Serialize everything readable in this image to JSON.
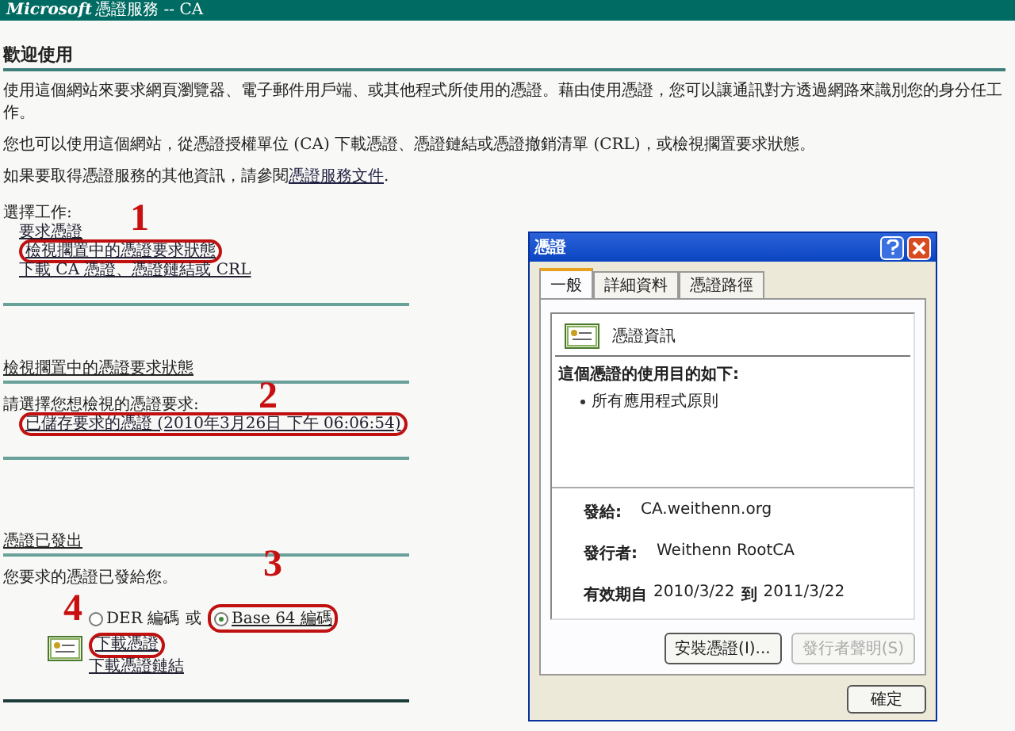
{
  "header": {
    "brand": "Microsoft",
    "title": "憑證服務 --  CA"
  },
  "welcome": {
    "heading": "歡迎使用",
    "paragraphs": [
      "使用這個網站來要求網頁瀏覽器、電子郵件用戶端、或其他程式所使用的憑證。藉由使用憑證，您可以讓通訊對方透過網路來識別您的身分任工作。",
      "您也可以使用這個網站，從憑證授權單位 (CA) 下載憑證、憑證鏈結或憑證撤銷清單 (CRL)，或檢視擱置要求狀態。"
    ],
    "more_info": {
      "text": "如果要取得憑證服務的其他資訊，請參閱",
      "link": "憑證服務文件",
      "end": "."
    }
  },
  "tasks": {
    "label": "選擇工作:",
    "links": [
      {
        "text": "要求憑證",
        "circled": false
      },
      {
        "text": "檢視擱置中的憑證要求狀態",
        "circled": true
      },
      {
        "text": "下載 CA 憑證、憑證鏈結或 CRL",
        "circled": false
      }
    ]
  },
  "pending": {
    "heading": "檢視擱置中的憑證要求狀態",
    "prompt": "請選擇您想檢視的憑證要求:",
    "links": [
      {
        "text": "已儲存要求的憑證 (2010年3月26日 下午 06:06:54)",
        "circled": true
      }
    ]
  },
  "issued": {
    "heading": "憑證已發出",
    "message": "您要求的憑證已發給您。",
    "separator": "或",
    "encodings": [
      {
        "label": "DER 編碼",
        "selected": false,
        "circled": false
      },
      {
        "label": "Base 64 編碼",
        "selected": true,
        "circled": true
      }
    ],
    "links": [
      {
        "text": "下載憑證",
        "circled": true
      },
      {
        "text": "下載憑證鏈結",
        "circled": false
      }
    ]
  },
  "annotations": [
    "1",
    "2",
    "3",
    "4"
  ],
  "dialog": {
    "title": "憑證",
    "tabs": [
      {
        "label": "一般",
        "selected": true
      },
      {
        "label": "詳細資料",
        "selected": false
      },
      {
        "label": "憑證路徑",
        "selected": false
      }
    ],
    "info_title": "憑證資訊",
    "purpose_heading": "這個憑證的使用目的如下:",
    "purposes": [
      "所有應用程式原則"
    ],
    "fields": [
      {
        "label": "發給:",
        "value": "CA.weithenn.org"
      },
      {
        "label": "發行者:",
        "value": "Weithenn RootCA"
      }
    ],
    "validity": {
      "label": "有效期自",
      "from": "2010/3/22",
      "to_label": "到",
      "to": "2011/3/22"
    },
    "buttons": [
      {
        "label": "安裝憑證(I)...",
        "disabled": false
      },
      {
        "label": "發行者聲明(S)",
        "disabled": true
      }
    ],
    "ok": "確定"
  }
}
